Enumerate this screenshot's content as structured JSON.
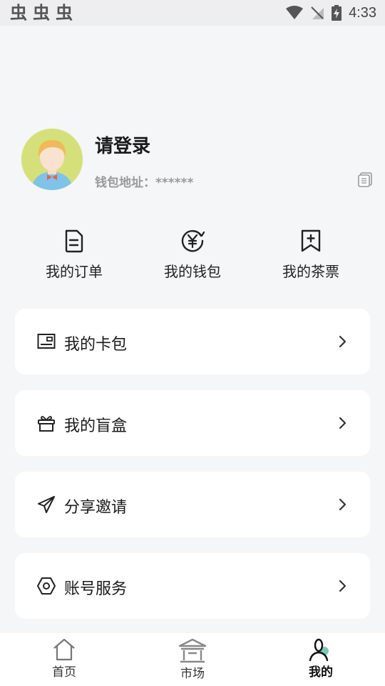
{
  "status_bar": {
    "left_icons": [
      "bug-icon",
      "bug-icon",
      "bug-icon"
    ],
    "bug_glyph": "虫",
    "time": "4:33",
    "right_icons": [
      "wifi-icon",
      "no-signal-icon",
      "battery-charging-icon"
    ]
  },
  "profile": {
    "name": "请登录",
    "wallet_label": "钱包地址：",
    "wallet_value": "******",
    "copy_icon": "copy-icon"
  },
  "quick_actions": [
    {
      "label": "我的订单",
      "icon": "document-icon"
    },
    {
      "label": "我的钱包",
      "icon": "yuan-coin-icon"
    },
    {
      "label": "我的茶票",
      "icon": "ticket-bookmark-icon"
    }
  ],
  "menu": [
    {
      "label": "我的卡包",
      "icon": "card-icon"
    },
    {
      "label": "我的盲盒",
      "icon": "gift-box-icon"
    },
    {
      "label": "分享邀请",
      "icon": "paper-plane-icon"
    },
    {
      "label": "账号服务",
      "icon": "hexagon-settings-icon"
    }
  ],
  "tabbar": [
    {
      "label": "首页",
      "icon": "home-icon",
      "active": false
    },
    {
      "label": "市场",
      "icon": "market-icon",
      "active": false
    },
    {
      "label": "我的",
      "icon": "user-icon",
      "active": true
    }
  ],
  "colors": {
    "background": "#f5f6f8",
    "card": "#ffffff",
    "avatar_bg": "#d6e07a",
    "muted_text": "#999999",
    "accent_teal": "#7cc7b8"
  }
}
